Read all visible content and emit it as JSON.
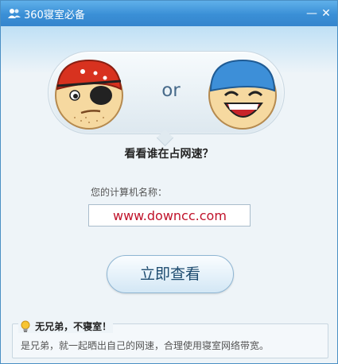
{
  "window": {
    "title": "360寝室必备",
    "icon": "user-group-icon",
    "minimize_icon": "minimize-icon",
    "close_icon": "close-icon"
  },
  "compare": {
    "left_icon": "pirate-face-icon",
    "vs_text": "or",
    "right_icon": "laughing-face-icon"
  },
  "question": "看看谁在占网速？",
  "computer_name": {
    "label": "您的计算机名称：",
    "value": "",
    "overlay_text": "www.downcc.com"
  },
  "action_button": "立即查看",
  "tip": {
    "icon": "lightbulb-icon",
    "title": "无兄弟，不寝室！",
    "text": "是兄弟，就一起晒出自己的网速，合理使用寝室网络带宽。"
  }
}
